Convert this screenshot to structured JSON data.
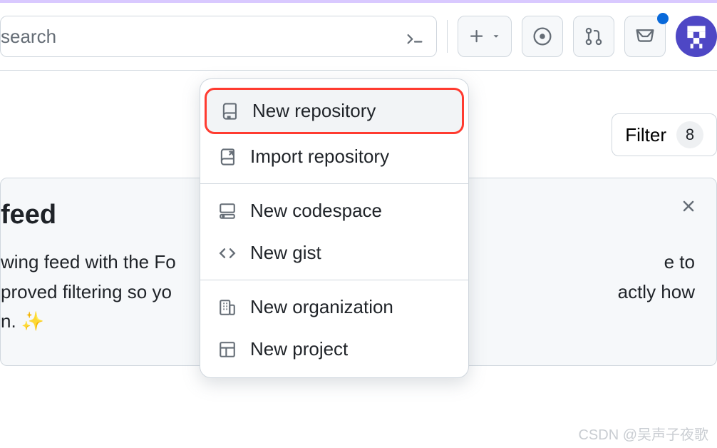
{
  "header": {
    "search_placeholder": "search"
  },
  "dropdown": {
    "items": [
      {
        "label": "New repository",
        "icon": "repo-icon",
        "highlighted": true
      },
      {
        "label": "Import repository",
        "icon": "import-icon"
      },
      {
        "sep": true
      },
      {
        "label": "New codespace",
        "icon": "codespace-icon"
      },
      {
        "label": "New gist",
        "icon": "code-icon"
      },
      {
        "sep": true
      },
      {
        "label": "New organization",
        "icon": "org-icon"
      },
      {
        "label": "New project",
        "icon": "project-icon"
      }
    ]
  },
  "filter": {
    "label": "Filter",
    "count": "8"
  },
  "feed": {
    "title": "feed",
    "line1": "wing feed with the Fo",
    "line1b": "e to",
    "line2": "proved filtering so yo",
    "line2b": "actly how",
    "line3": "n. ✨"
  },
  "watermark": "CSDN @吴声子夜歌"
}
